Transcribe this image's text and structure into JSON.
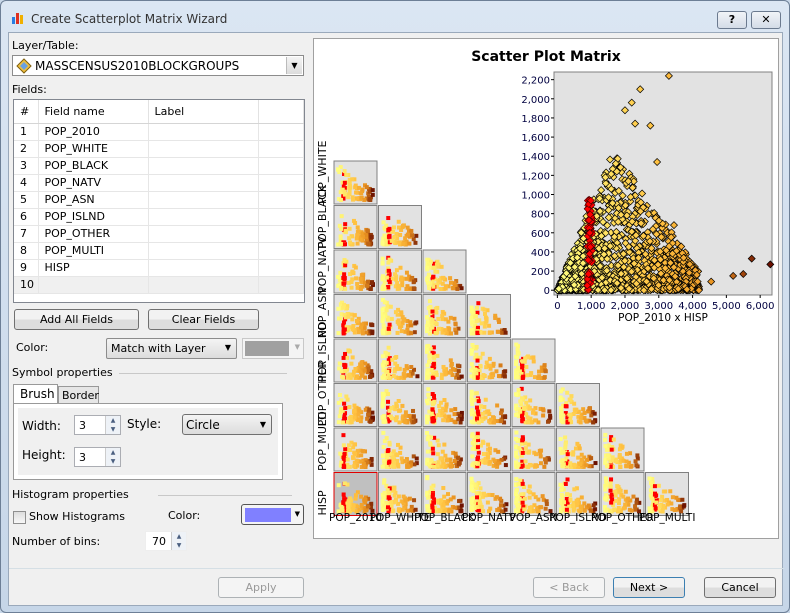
{
  "window": {
    "title": "Create Scatterplot Matrix Wizard",
    "help_label": "?",
    "close_label": "✕"
  },
  "layer": {
    "label": "Layer/Table:",
    "value": "MASSCENSUS2010BLOCKGROUPS"
  },
  "fields": {
    "label": "Fields:",
    "columns": [
      "#",
      "Field name",
      "Label"
    ],
    "rows": [
      [
        "1",
        "POP_2010",
        ""
      ],
      [
        "2",
        "POP_WHITE",
        ""
      ],
      [
        "3",
        "POP_BLACK",
        ""
      ],
      [
        "4",
        "POP_NATV",
        ""
      ],
      [
        "5",
        "POP_ASN",
        ""
      ],
      [
        "6",
        "POP_ISLND",
        ""
      ],
      [
        "7",
        "POP_OTHER",
        ""
      ],
      [
        "8",
        "POP_MULTI",
        ""
      ],
      [
        "9",
        "HISP",
        ""
      ],
      [
        "10",
        "",
        ""
      ]
    ]
  },
  "buttons": {
    "add_all": "Add All Fields",
    "clear": "Clear Fields",
    "apply": "Apply",
    "back": "< Back",
    "next": "Next >",
    "cancel": "Cancel"
  },
  "color": {
    "label": "Color:",
    "mode": "Match with Layer",
    "swatch": "#a0a0a0"
  },
  "symbol": {
    "title": "Symbol properties",
    "tabs": [
      "Brush",
      "Border"
    ],
    "width_label": "Width:",
    "width": "3",
    "height_label": "Height:",
    "height": "3",
    "style_label": "Style:",
    "style": "Circle"
  },
  "histogram": {
    "title": "Histogram properties",
    "show_label": "Show Histograms",
    "show": false,
    "color_label": "Color:",
    "color": "#8080ff",
    "bins_label": "Number of bins:",
    "bins": "70"
  },
  "matrix": {
    "title": "Scatter Plot Matrix",
    "variables": [
      "POP_2010",
      "POP_WHITE",
      "POP_BLACK",
      "POP_NATV",
      "POP_ASN",
      "POP_ISLND",
      "POP_OTHER",
      "POP_MULTI",
      "HISP"
    ],
    "selected": "POP_2010 x HISP",
    "detail": {
      "xlabel": "POP_2010 x HISP",
      "xticks": [
        "0",
        "1,000",
        "2,000",
        "3,000",
        "4,000",
        "5,000",
        "6,000"
      ],
      "yticks": [
        "0",
        "200",
        "400",
        "600",
        "800",
        "1,000",
        "1,200",
        "1,400",
        "1,600",
        "1,800",
        "2,000",
        "2,200"
      ],
      "xrange": [
        -100,
        6350
      ],
      "yrange": [
        -50,
        2280
      ],
      "highlight_color": "#ff0000",
      "ramp": [
        "#ffff80",
        "#ffc040",
        "#e89020",
        "#6b1000"
      ]
    }
  }
}
